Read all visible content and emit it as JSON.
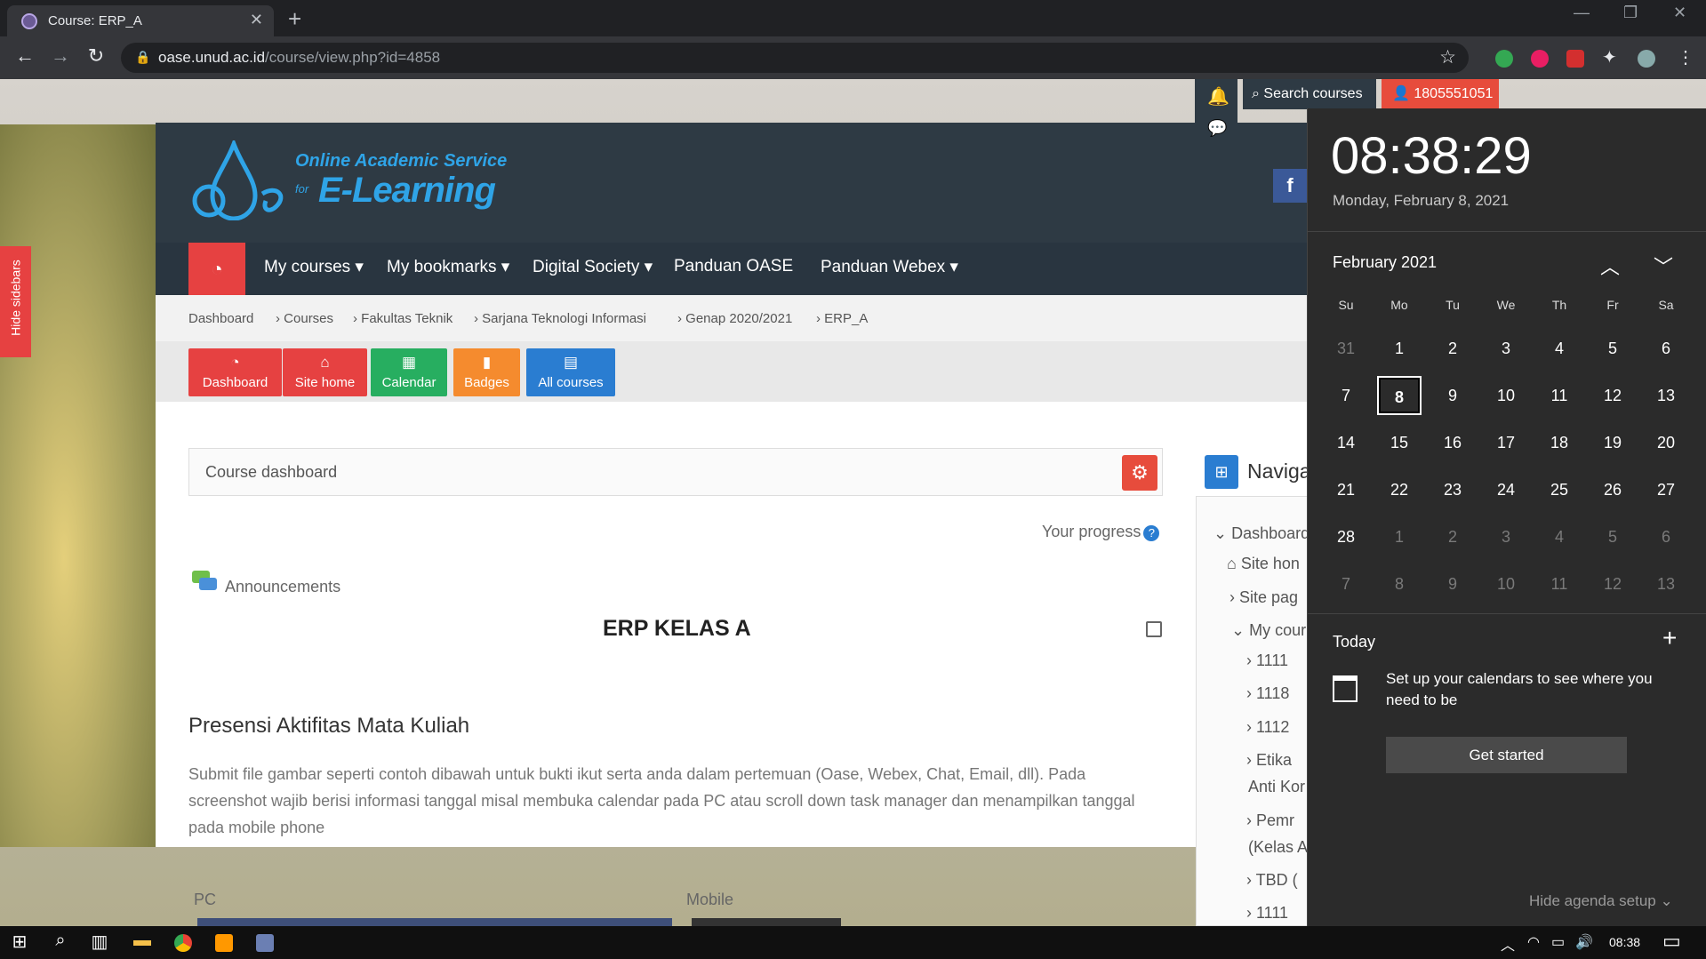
{
  "browser": {
    "tab_title": "Course: ERP_A",
    "url_host": "oase.unud.ac.id",
    "url_path": "/course/view.php?id=4858"
  },
  "site": {
    "logo_line1": "Online Academic Service",
    "logo_line2": "E-Learning",
    "logo_for": "for",
    "search_label": "Search courses",
    "user_id": "1805551051",
    "facebook": "f",
    "hide_sidebars": "Hide sidebars"
  },
  "nav": {
    "items": [
      "My courses",
      "My bookmarks",
      "Digital Society",
      "Panduan OASE",
      "Panduan Webex"
    ]
  },
  "breadcrumb": [
    "Dashboard",
    "Courses",
    "Fakultas Teknik",
    "Sarjana Teknologi Informasi",
    "Genap 2020/2021",
    "ERP_A"
  ],
  "quicklinks": [
    "Dashboard",
    "Site home",
    "Calendar",
    "Badges",
    "All courses"
  ],
  "course": {
    "dashboard_label": "Course dashboard",
    "progress_label": "Your progress",
    "announcements": "Announcements",
    "section_title": "ERP KELAS A",
    "presensi_title": "Presensi Aktifitas Mata Kuliah",
    "presensi_desc": "Submit file gambar seperti contoh dibawah untuk bukti ikut serta anda dalam pertemuan (Oase, Webex, Chat, Email, dll). Pada screenshot wajib berisi informasi tanggal misal membuka calendar pada PC atau scroll down task manager dan menampilkan tanggal pada mobile phone",
    "pc_label": "PC",
    "mobile_label": "Mobile"
  },
  "navigation_block": {
    "title": "Naviga",
    "items": [
      "Dashboard",
      "Site hon",
      "Site pag",
      "My cour",
      "1111",
      "1118",
      "1112",
      "Etika",
      "Anti Kor",
      "Pemr",
      "(Kelas A",
      "TBD (",
      "1111"
    ]
  },
  "calendar": {
    "time": "08:38:29",
    "date": "Monday, February 8, 2021",
    "month": "February 2021",
    "weekdays": [
      "Su",
      "Mo",
      "Tu",
      "We",
      "Th",
      "Fr",
      "Sa"
    ],
    "weeks": [
      [
        "31",
        "1",
        "2",
        "3",
        "4",
        "5",
        "6"
      ],
      [
        "7",
        "8",
        "9",
        "10",
        "11",
        "12",
        "13"
      ],
      [
        "14",
        "15",
        "16",
        "17",
        "18",
        "19",
        "20"
      ],
      [
        "21",
        "22",
        "23",
        "24",
        "25",
        "26",
        "27"
      ],
      [
        "28",
        "1",
        "2",
        "3",
        "4",
        "5",
        "6"
      ],
      [
        "7",
        "8",
        "9",
        "10",
        "11",
        "12",
        "13"
      ]
    ],
    "selected_day": "8",
    "today_label": "Today",
    "setup_text": "Set up your calendars to see where you need to be",
    "get_started": "Get started",
    "hide_agenda": "Hide agenda setup"
  },
  "taskbar": {
    "clock": "08:38"
  }
}
